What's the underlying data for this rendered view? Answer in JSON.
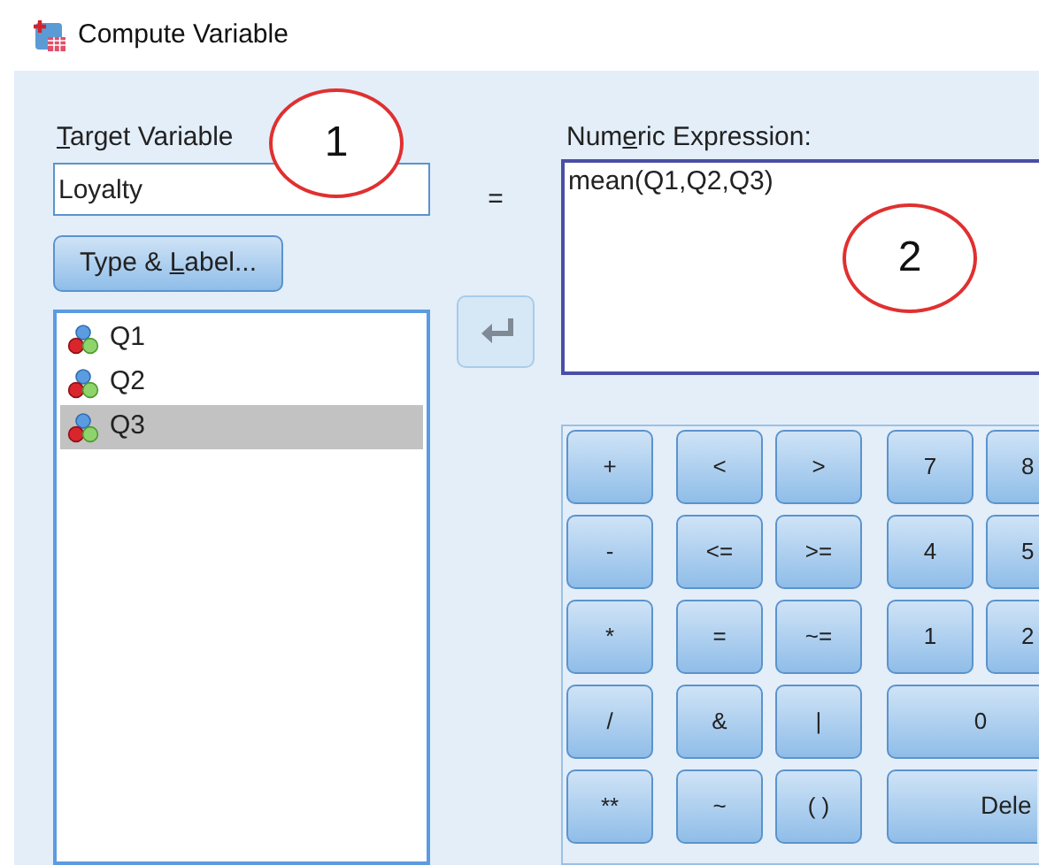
{
  "window": {
    "title": "Compute Variable"
  },
  "target": {
    "label": {
      "key": "T",
      "after": "arget Variable"
    },
    "value": "Loyalty"
  },
  "equals": "=",
  "type_label_button": {
    "before": "Type & ",
    "key": "L",
    "after": "abel..."
  },
  "variables": [
    {
      "name": "Q1",
      "selected": false
    },
    {
      "name": "Q2",
      "selected": false
    },
    {
      "name": "Q3",
      "selected": true
    }
  ],
  "expression": {
    "label": {
      "before": "Num",
      "key": "e",
      "after": "ric Expression:"
    },
    "value": "mean(Q1,Q2,Q3)"
  },
  "keypad": [
    [
      {
        "label": "+"
      },
      {
        "label": "<"
      },
      {
        "label": ">"
      },
      {
        "label": "7"
      },
      {
        "label": "8"
      }
    ],
    [
      {
        "label": "-"
      },
      {
        "label": "<="
      },
      {
        "label": ">="
      },
      {
        "label": "4"
      },
      {
        "label": "5"
      }
    ],
    [
      {
        "label": "*"
      },
      {
        "label": "="
      },
      {
        "label": "~="
      },
      {
        "label": "1"
      },
      {
        "label": "2"
      }
    ],
    [
      {
        "label": "/"
      },
      {
        "label": "&"
      },
      {
        "label": "|"
      },
      {
        "label": "0",
        "wide": true
      }
    ],
    [
      {
        "label": "**"
      },
      {
        "label": "~"
      },
      {
        "label": "( )"
      },
      {
        "label": "Dele",
        "wide": true
      }
    ]
  ],
  "annotations": [
    {
      "label": "1"
    },
    {
      "label": "2"
    }
  ]
}
